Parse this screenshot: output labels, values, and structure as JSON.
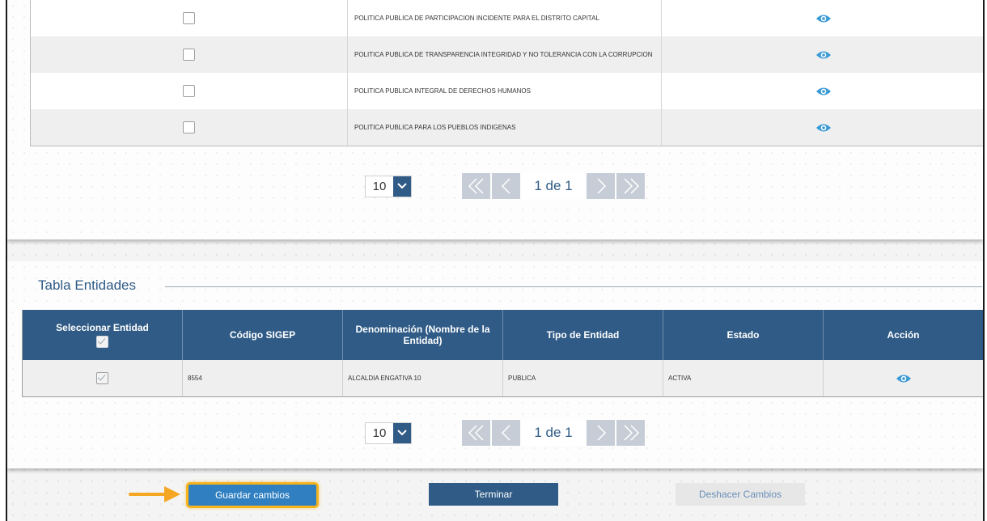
{
  "policies": {
    "rows": [
      {
        "name": "POLITICA PUBLICA DE PARTICIPACION INCIDENTE PARA EL DISTRITO CAPITAL"
      },
      {
        "name": "POLITICA PUBLICA DE TRANSPARENCIA INTEGRIDAD Y NO TOLERANCIA CON LA CORRUPCION"
      },
      {
        "name": "POLITICA PUBLICA INTEGRAL DE DERECHOS HUMANOS"
      },
      {
        "name": "POLITICA PUBLICA PARA LOS PUEBLOS INDIGENAS"
      }
    ],
    "pager": {
      "page_size": "10",
      "page_text": "1 de 1"
    }
  },
  "entities": {
    "title": "Tabla Entidades",
    "headers": {
      "select": "Seleccionar Entidad",
      "code": "Código SIGEP",
      "name": "Denominación (Nombre de la Entidad)",
      "type": "Tipo de Entidad",
      "status": "Estado",
      "action": "Acción"
    },
    "rows": [
      {
        "code": "8554",
        "name": "ALCALDIA ENGATIVA 10",
        "type": "PUBLICA",
        "status": "ACTIVA"
      }
    ],
    "pager": {
      "page_size": "10",
      "page_text": "1 de 1"
    }
  },
  "actions": {
    "save": "Guardar cambios",
    "finish": "Terminar",
    "undo": "Deshacer Cambios"
  },
  "colors": {
    "primary": "#2f5b86",
    "eye": "#3a9ad6",
    "highlight": "#f5b41c"
  },
  "icons": {
    "view": "eye-icon",
    "first": "double-chevron-left-icon",
    "prev": "chevron-left-icon",
    "next": "chevron-right-icon",
    "last": "double-chevron-right-icon",
    "dropdown": "chevron-down-icon"
  }
}
